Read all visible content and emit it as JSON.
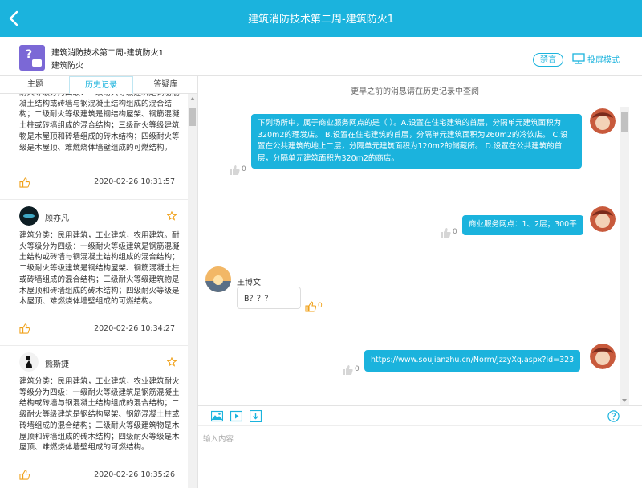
{
  "header": {
    "title": "建筑消防技术第二周-建筑防火1"
  },
  "room": {
    "name": "建筑消防技术第二周-建筑防火1",
    "subtitle": "建筑防火",
    "mute_label": "禁言",
    "projection_label": "投屏模式"
  },
  "tabs": [
    {
      "label": "主题"
    },
    {
      "label": "历史记录"
    },
    {
      "label": "答疑库"
    }
  ],
  "posts": [
    {
      "body": "耐火等级分为四级：一级耐火等级建筑是钢筋混凝土结构或砖墙与钢混凝土结构组成的混合结构；二级耐火等级建筑是钢结构屋架、钢筋混凝土柱或砖墙组成的混合结构；三级耐火等级建筑物是木屋顶和砖墙组成的砖木结构；四级耐火等级是木屋顶、难燃烧体墙壁组成的可燃结构。",
      "time": "2020-02-26 10:31:57"
    },
    {
      "author": "顾亦凡",
      "body": "建筑分类：民用建筑，工业建筑，农用建筑。耐火等级分为四级：一级耐火等级建筑是钢筋混凝土结构或砖墙与钢混凝土结构组成的混合结构；二级耐火等级建筑是钢结构屋架、钢筋混凝土柱或砖墙组成的混合结构；三级耐火等级建筑物是木屋顶和砖墙组成的砖木结构；四级耐火等级是木屋顶、难燃烧体墙壁组成的可燃结构。",
      "time": "2020-02-26 10:34:27"
    },
    {
      "author": "熊斯捷",
      "body": "建筑分类：民用建筑，工业建筑，农业建筑耐火等级分为四级：一级耐火等级建筑是钢筋混凝土结构或砖墙与钢混凝土结构组成的混合结构；二级耐火等级建筑是钢结构屋架、钢筋混凝土柱或砖墙组成的混合结构；三级耐火等级建筑物是木屋顶和砖墙组成的砖木结构；四级耐火等级是木屋顶、难燃烧体墙壁组成的可燃结构。",
      "time": "2020-02-26 10:35:26"
    }
  ],
  "chat": {
    "notice": "更早之前的消息请在历史记录中查阅",
    "messages": [
      {
        "text": "下列场所中，属于商业服务网点的是（ ）。A.设置在住宅建筑的首层，分隔单元建筑面积为320m2的理发店。 B.设置在住宅建筑的首层，分隔单元建筑面积为260m2的冷饮店。 C.设置在公共建筑的地上二层，分隔单元建筑面积为120m2的储藏所。 D.设置在公共建筑的首层，分隔单元建筑面积为320m2的商店。",
        "likes": "0"
      },
      {
        "text": "商业服务网点：1、2层；300平",
        "likes": "0"
      },
      {
        "sender": "王博文",
        "text": "B？？？",
        "likes": "0"
      },
      {
        "text": "https://www.soujianzhu.cn/Norm/JzzyXq.aspx?id=323",
        "likes": "0"
      }
    ]
  },
  "composer": {
    "placeholder": "输入内容"
  },
  "colors": {
    "accent": "#1bb3dd",
    "like": "#f0a11a"
  }
}
